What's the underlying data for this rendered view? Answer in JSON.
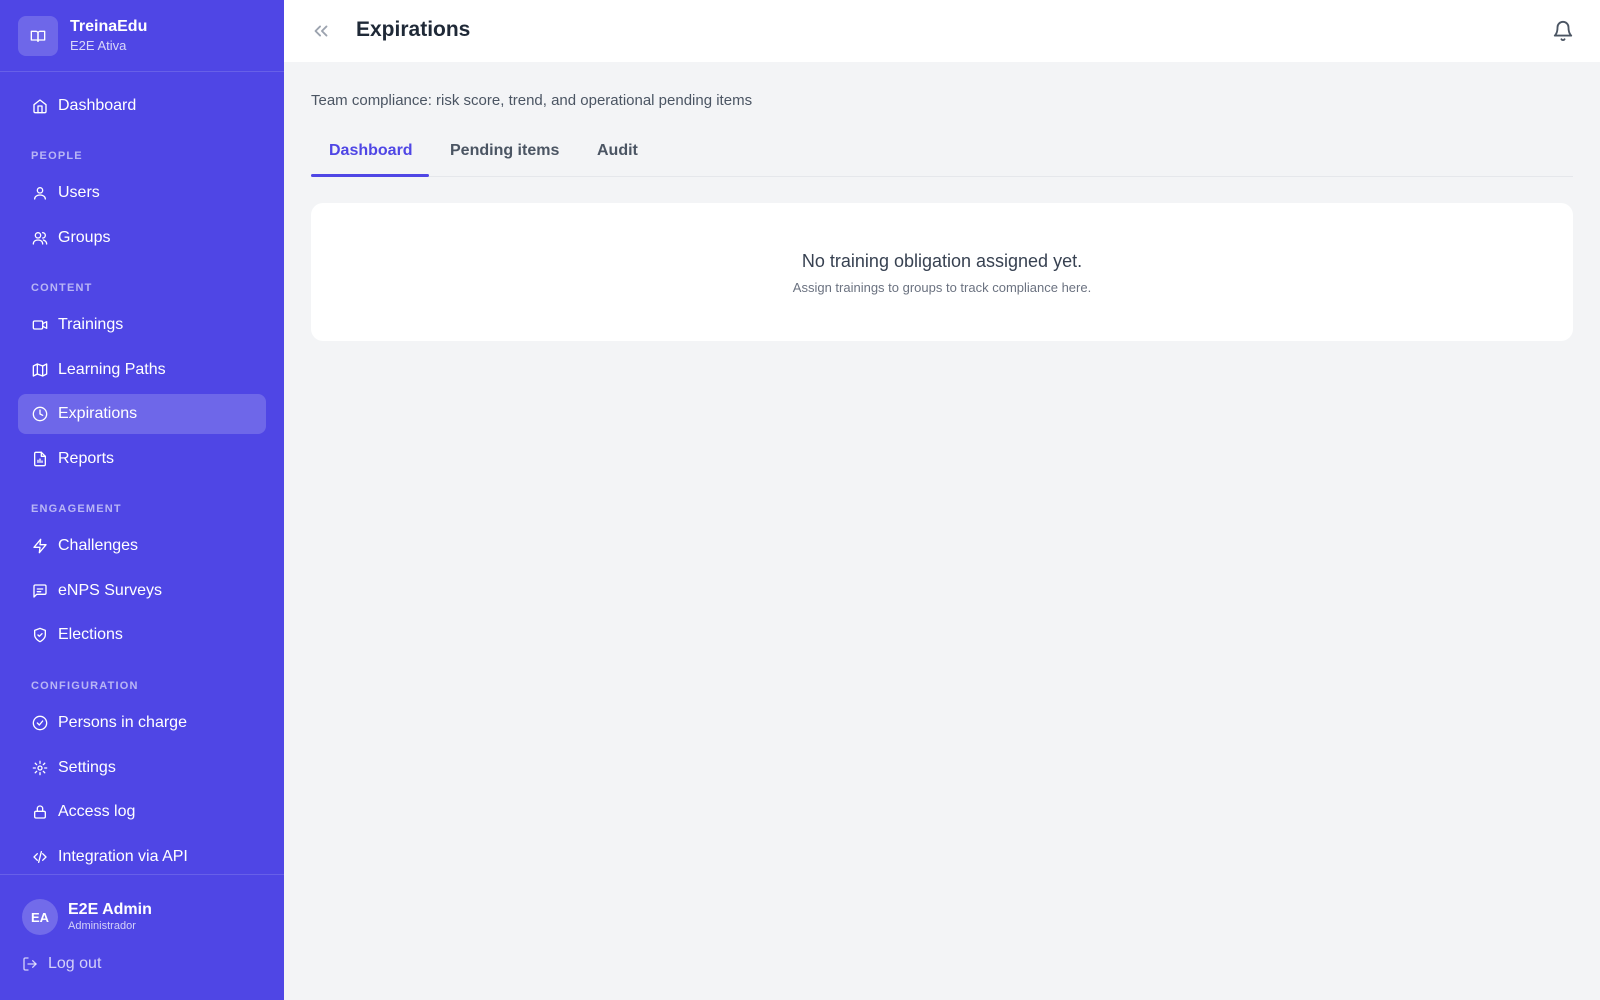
{
  "brand": {
    "name": "TreinaEdu",
    "subtitle": "E2E Ativa"
  },
  "sidebar": {
    "sections": [
      {
        "label": "PEOPLE"
      },
      {
        "label": "CONTENT"
      },
      {
        "label": "ENGAGEMENT"
      },
      {
        "label": "CONFIGURATION"
      }
    ],
    "items": [
      {
        "label": "Dashboard",
        "icon": "home-icon"
      },
      {
        "label": "Users",
        "icon": "user-icon"
      },
      {
        "label": "Groups",
        "icon": "users-icon"
      },
      {
        "label": "Trainings",
        "icon": "video-icon"
      },
      {
        "label": "Learning Paths",
        "icon": "map-icon"
      },
      {
        "label": "Expirations",
        "icon": "clock-icon",
        "active": true
      },
      {
        "label": "Reports",
        "icon": "file-chart-icon"
      },
      {
        "label": "Challenges",
        "icon": "zap-icon"
      },
      {
        "label": "eNPS Surveys",
        "icon": "message-icon"
      },
      {
        "label": "Elections",
        "icon": "shield-icon"
      },
      {
        "label": "Persons in charge",
        "icon": "check-circle-icon"
      },
      {
        "label": "Settings",
        "icon": "gear-icon"
      },
      {
        "label": "Access log",
        "icon": "lock-icon"
      },
      {
        "label": "Integration via API",
        "icon": "code-icon"
      }
    ]
  },
  "user": {
    "initials": "EA",
    "name": "E2E Admin",
    "role": "Administrador"
  },
  "logout_label": "Log out",
  "header": {
    "title": "Expirations"
  },
  "main": {
    "subtitle": "Team compliance: risk score, trend, and operational pending items",
    "tabs": [
      {
        "label": "Dashboard",
        "active": true
      },
      {
        "label": "Pending items"
      },
      {
        "label": "Audit"
      }
    ],
    "empty_state": {
      "title": "No training obligation assigned yet.",
      "message": "Assign trainings to groups to track compliance here."
    }
  },
  "colors": {
    "sidebar_bg": "#4f46e5",
    "accent": "#4f46e5",
    "page_bg": "#f3f4f6"
  }
}
